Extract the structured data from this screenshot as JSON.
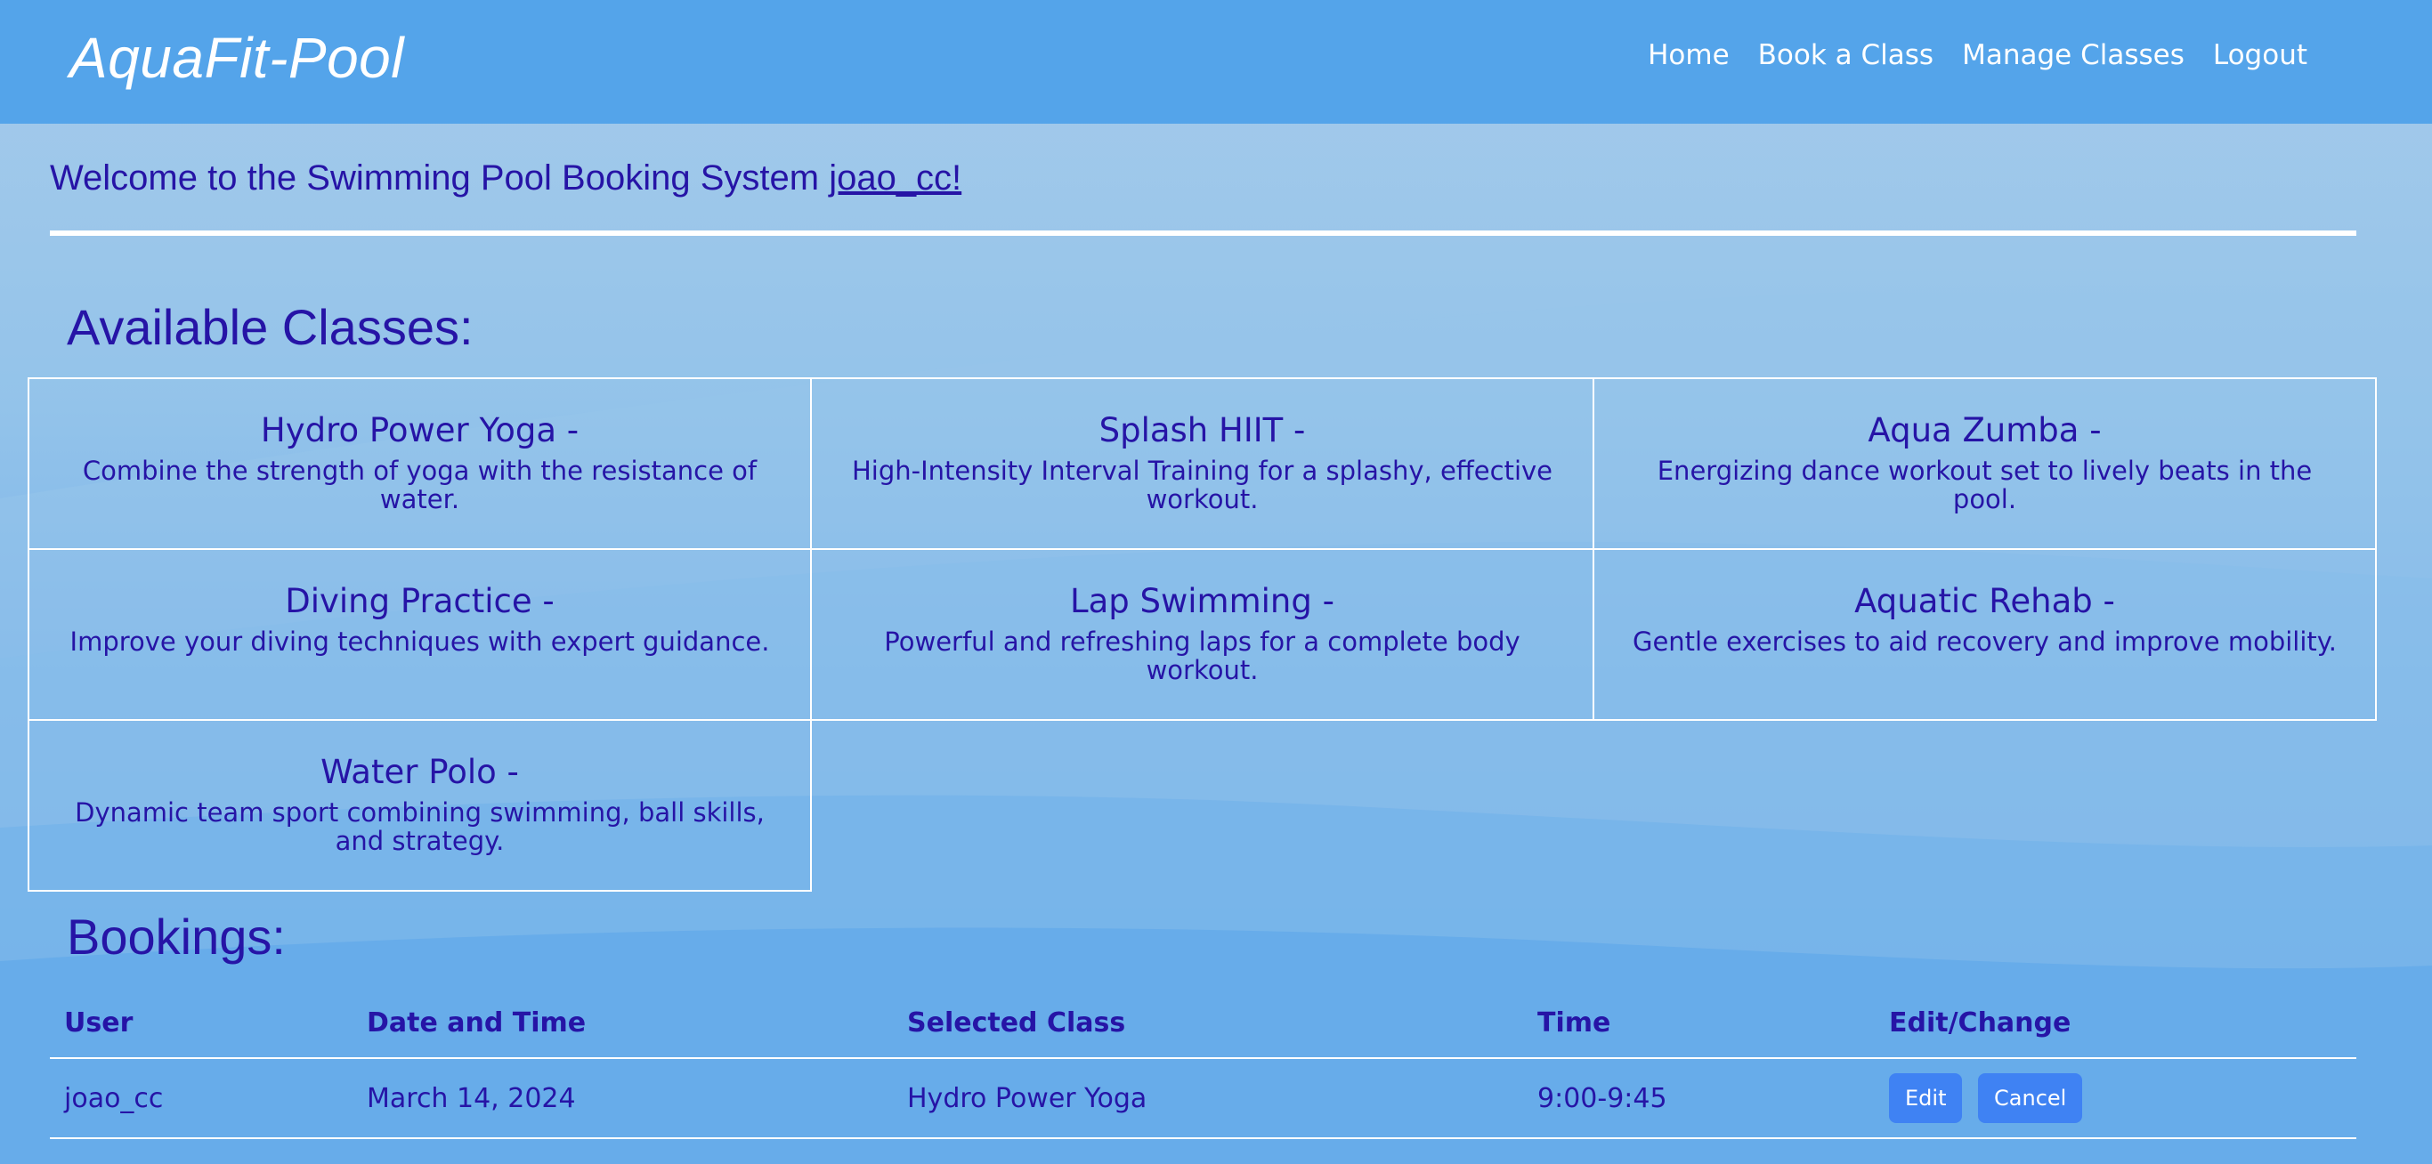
{
  "nav": {
    "brand": "AquaFit-Pool",
    "links": [
      "Home",
      "Book a Class",
      "Manage Classes",
      "Logout"
    ]
  },
  "welcome": {
    "text": "Welcome to the Swimming Pool Booking System ",
    "username": "joao_cc!"
  },
  "classes": {
    "title": "Available Classes:",
    "items": [
      {
        "name": "Hydro Power Yoga -",
        "desc": "Combine the strength of yoga with the resistance of water."
      },
      {
        "name": "Splash HIIT -",
        "desc": "High-Intensity Interval Training for a splashy, effective workout."
      },
      {
        "name": "Aqua Zumba -",
        "desc": "Energizing dance workout set to lively beats in the pool."
      },
      {
        "name": "Diving Practice -",
        "desc": "Improve your diving techniques with expert guidance."
      },
      {
        "name": "Lap Swimming -",
        "desc": "Powerful and refreshing laps for a complete body workout."
      },
      {
        "name": "Aquatic Rehab -",
        "desc": "Gentle exercises to aid recovery and improve mobility."
      },
      {
        "name": "Water Polo -",
        "desc": "Dynamic team sport combining swimming, ball skills, and strategy."
      }
    ]
  },
  "bookings": {
    "title": "Bookings:",
    "headers": [
      "User",
      "Date and Time",
      "Selected Class",
      "Time",
      "Edit/Change"
    ],
    "rows": [
      {
        "user": "joao_cc",
        "date": "March 14, 2024",
        "class": "Hydro Power Yoga",
        "time": "9:00-9:45",
        "edit_label": "Edit",
        "cancel_label": "Cancel"
      }
    ]
  },
  "colors": {
    "navbar": "#54a4ea",
    "text": "#2614a6",
    "button": "#3f82f3"
  }
}
